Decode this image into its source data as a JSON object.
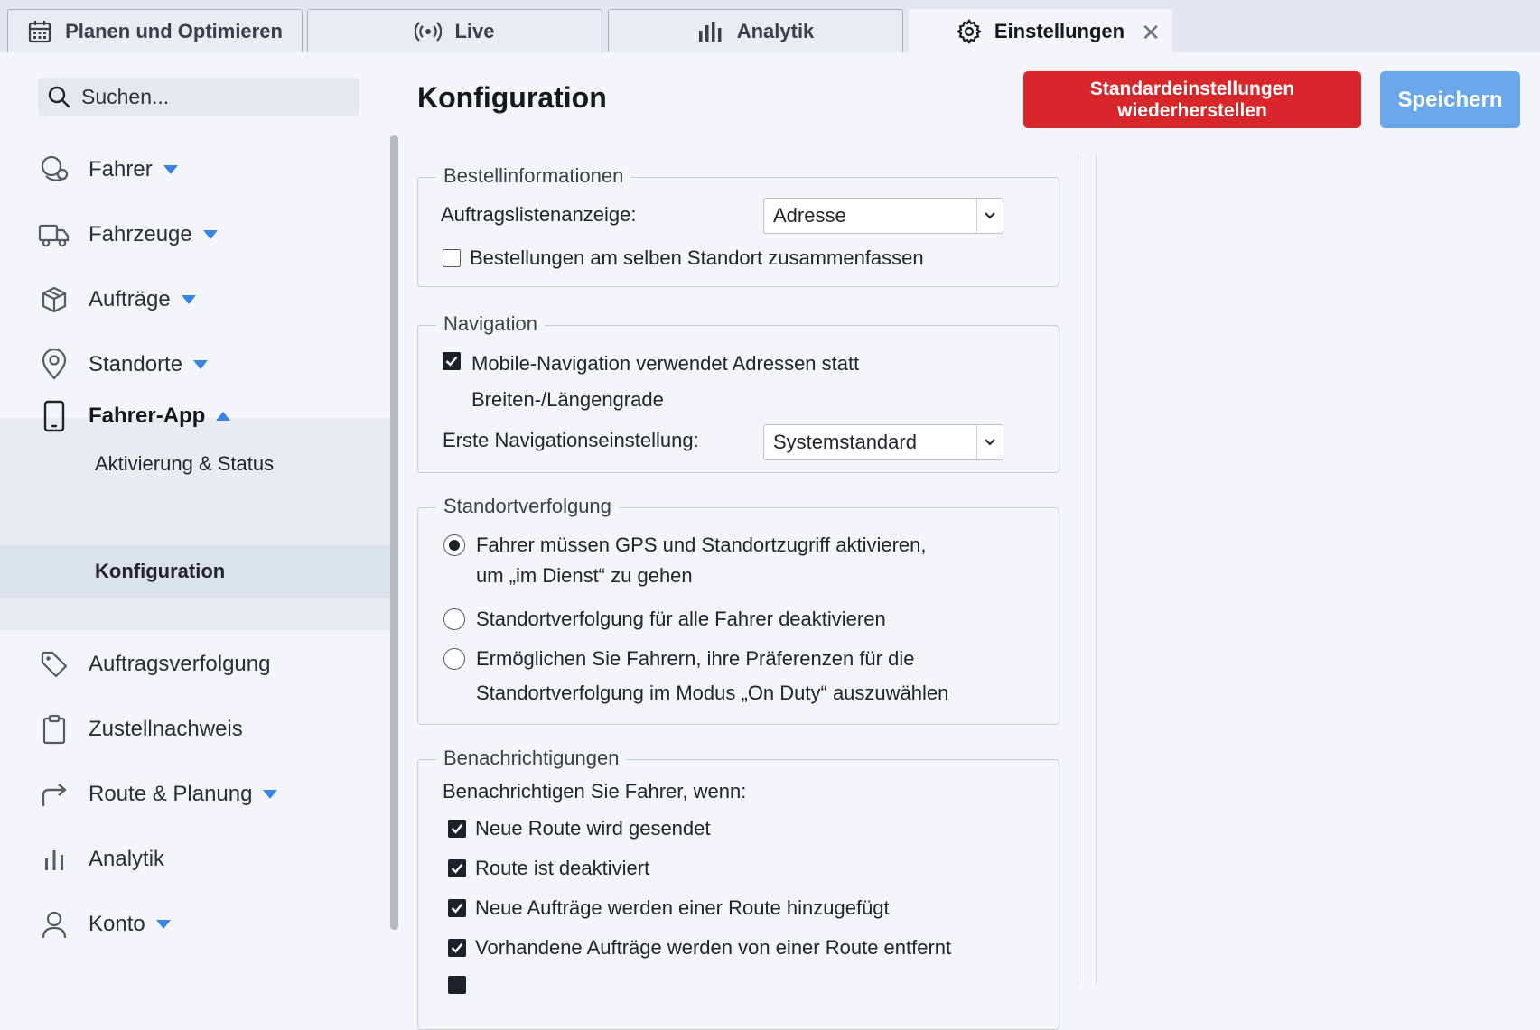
{
  "tabs": [
    {
      "label": "Planen und Optimieren",
      "icon": "calendar-icon"
    },
    {
      "label": "Live",
      "icon": "broadcast-icon"
    },
    {
      "label": "Analytik",
      "icon": "bar-chart-icon"
    },
    {
      "label": "Einstellungen",
      "icon": "gear-icon",
      "active": true
    }
  ],
  "search": {
    "placeholder": "Suchen..."
  },
  "sidebar": {
    "items": [
      {
        "label": "Fahrer",
        "icon": "drivers-icon"
      },
      {
        "label": "Fahrzeuge",
        "icon": "truck-icon"
      },
      {
        "label": "Aufträge",
        "icon": "package-icon"
      },
      {
        "label": "Standorte",
        "icon": "map-pin-icon"
      },
      {
        "label": "Fahrer-App",
        "icon": "smartphone-icon"
      },
      {
        "label": "Auftragsverfolgung",
        "icon": "tag-icon"
      },
      {
        "label": "Zustellnachweis",
        "icon": "clipboard-icon"
      },
      {
        "label": "Route & Planung",
        "icon": "route-arrow-icon"
      },
      {
        "label": "Analytik",
        "icon": "bar-chart-icon"
      },
      {
        "label": "Konto",
        "icon": "user-icon"
      }
    ],
    "subitems": [
      {
        "label": "Aktivierung & Status"
      },
      {
        "label": "Konfiguration",
        "active": true
      }
    ]
  },
  "main": {
    "title": "Konfiguration",
    "reset_label": "Standardeinstellungen wiederherstellen",
    "save_label": "Speichern"
  },
  "sections": {
    "orders": {
      "legend": "Bestellinformationen",
      "list_display_label": "Auftragslistenanzeige:",
      "list_display_value": "Adresse",
      "combine_label": "Bestellungen am selben Standort zusammenfassen",
      "combine_checked": false
    },
    "navigation": {
      "legend": "Navigation",
      "mobile_nav_line1": "Mobile-Navigation verwendet Adressen statt",
      "mobile_nav_line2": "Breiten-/Längengrade",
      "mobile_nav_checked": true,
      "first_setting_label": "Erste Navigationseinstellung:",
      "first_setting_value": "Systemstandard"
    },
    "tracking": {
      "legend": "Standortverfolgung",
      "options": [
        {
          "line1": "Fahrer müssen GPS und Standortzugriff aktivieren,",
          "line2": "um „im Dienst“ zu gehen",
          "selected": true
        },
        {
          "line1": "Standortverfolgung für alle Fahrer deaktivieren",
          "line2": "",
          "selected": false
        },
        {
          "line1": "Ermöglichen Sie Fahrern, ihre Präferenzen für die",
          "line2": "Standortverfolgung im Modus „On Duty“ auszuwählen",
          "selected": false
        }
      ]
    },
    "notifications": {
      "legend": "Benachrichtigungen",
      "intro": "Benachrichtigen Sie Fahrer, wenn:",
      "items": [
        {
          "label": "Neue Route wird gesendet",
          "checked": true
        },
        {
          "label": "Route ist deaktiviert",
          "checked": true
        },
        {
          "label": "Neue Aufträge werden einer Route hinzugefügt",
          "checked": true
        },
        {
          "label": "Vorhandene Aufträge werden von einer Route entfernt",
          "checked": true
        }
      ]
    }
  },
  "colors": {
    "danger": "#d9262b",
    "primary_light": "#6aa7ea",
    "caret": "#3b82e6"
  }
}
